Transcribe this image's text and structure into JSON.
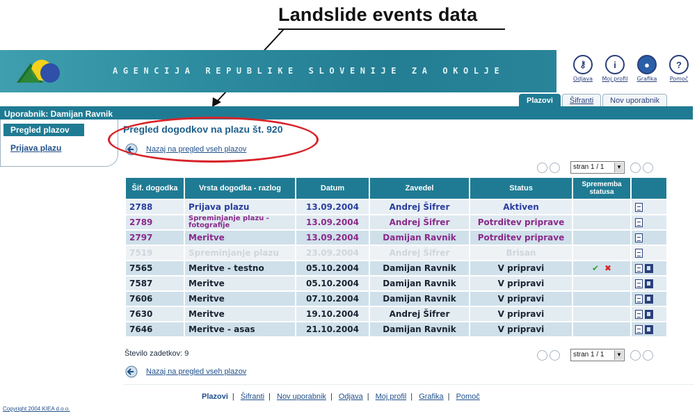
{
  "annotation": {
    "title": "Landslide events data"
  },
  "header": {
    "agency": "AGENCIJA REPUBLIKE SLOVENIJE ZA OKOLJE",
    "icons": [
      {
        "name": "odjava",
        "label": "Odjava",
        "glyph": "key"
      },
      {
        "name": "moj-profil",
        "label": "Moj profil",
        "glyph": "info"
      },
      {
        "name": "grafika",
        "label": "Grafika",
        "glyph": "globe"
      },
      {
        "name": "pomoc",
        "label": "Pomoč",
        "glyph": "?"
      }
    ]
  },
  "tabs": [
    "Plazovi",
    "Šifranti",
    "Nov uporabnik"
  ],
  "user": "Uporabnik: Damijan Ravnik",
  "sidebar": {
    "active": "Pregled plazov",
    "link": "Prijava plazu"
  },
  "main": {
    "title": "Pregled dogodkov na plazu št. 920",
    "back_link": "Nazaj na pregled vseh plazov",
    "pager_label": "stran 1 / 1",
    "count": "Število zadetkov: 9"
  },
  "table": {
    "headers": [
      "Šif. dogodka",
      "Vrsta dogodka - razlog",
      "Datum",
      "Zavedel",
      "Status",
      "Sprememba statusa",
      ""
    ],
    "rows": [
      {
        "id": "2788",
        "vrsta": "Prijava plazu",
        "datum": "13.09.2004",
        "zavedel": "Andrej Šifrer",
        "status": "Aktiven"
      },
      {
        "id": "2789",
        "vrsta": "Spreminjanje plazu - fotografije",
        "datum": "13.09.2004",
        "zavedel": "Andrej Šifrer",
        "status": "Potrditev priprave"
      },
      {
        "id": "2797",
        "vrsta": "Meritve",
        "datum": "13.09.2004",
        "zavedel": "Damijan Ravnik",
        "status": "Potrditev priprave"
      },
      {
        "id": "7519",
        "vrsta": "Spreminjanje plazu",
        "datum": "23.09.2004",
        "zavedel": "Andrej Šifrer",
        "status": "Brisan"
      },
      {
        "id": "7565",
        "vrsta": "Meritve - testno",
        "datum": "05.10.2004",
        "zavedel": "Damijan Ravnik",
        "status": "V pripravi"
      },
      {
        "id": "7587",
        "vrsta": "Meritve",
        "datum": "05.10.2004",
        "zavedel": "Damijan Ravnik",
        "status": "V pripravi"
      },
      {
        "id": "7606",
        "vrsta": "Meritve",
        "datum": "07.10.2004",
        "zavedel": "Damijan Ravnik",
        "status": "V pripravi"
      },
      {
        "id": "7630",
        "vrsta": "Meritve",
        "datum": "19.10.2004",
        "zavedel": "Andrej Šifrer",
        "status": "V pripravi"
      },
      {
        "id": "7646",
        "vrsta": "Meritve - asas",
        "datum": "21.10.2004",
        "zavedel": "Damijan Ravnik",
        "status": "V pripravi"
      }
    ]
  },
  "footer": {
    "links": [
      "Plazovi",
      "Šifranti",
      "Nov uporabnik",
      "Odjava",
      "Moj profil",
      "Grafika",
      "Pomoč"
    ],
    "copyright": "Copyright 2004 KIEA d.o.o."
  },
  "colors": {
    "header_teal": "#1f7b93",
    "highlight_red": "#d8232a",
    "link_blue": "#1f4f8a"
  }
}
